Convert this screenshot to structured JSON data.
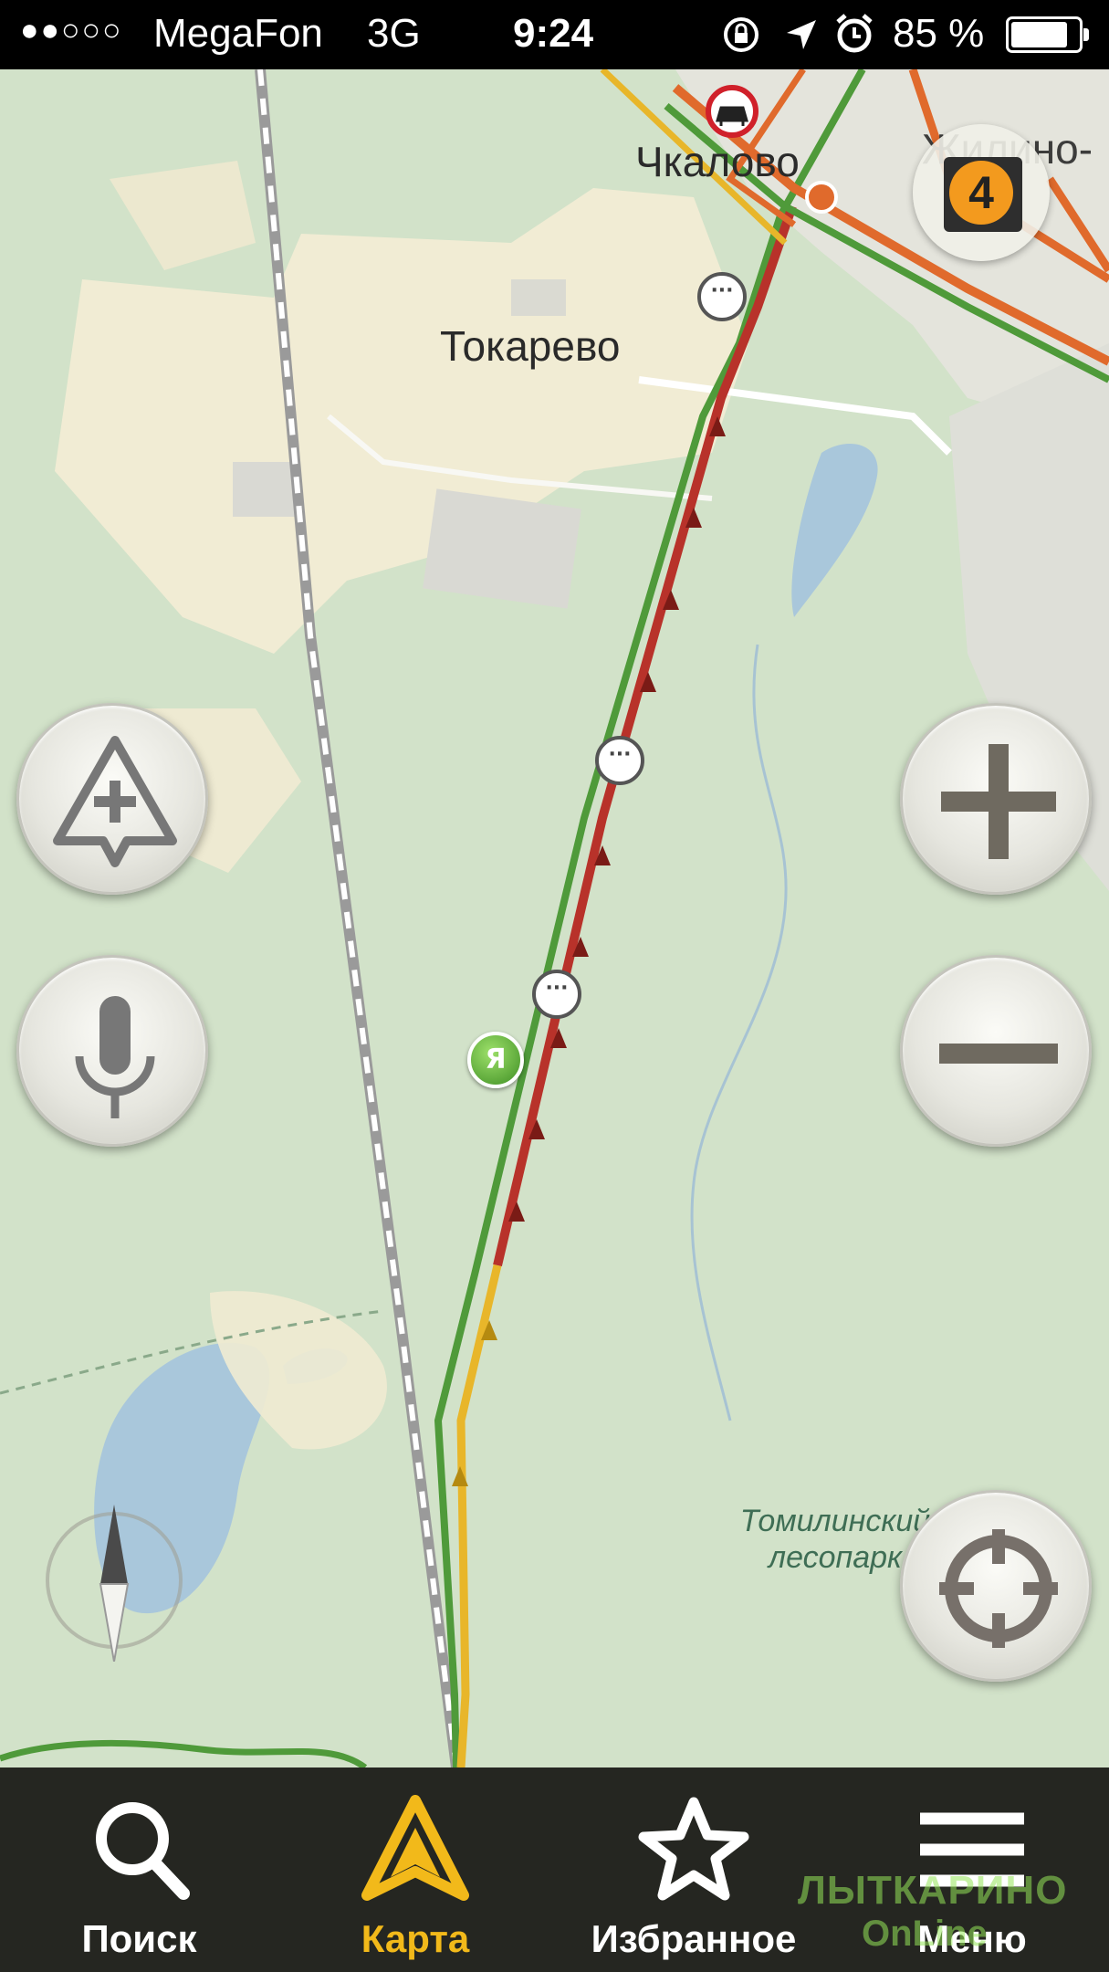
{
  "status_bar": {
    "signal_dots": "●●○○○",
    "carrier": "MegaFon",
    "network": "3G",
    "time": "9:24",
    "battery_percent": "85 %",
    "battery_level": 0.85
  },
  "map": {
    "places": {
      "tokarevo": "Токарево",
      "chkalovo": "Чкалово",
      "zhukovo_partial": "Жилино-"
    },
    "park_label": "Томилинский лесопарк",
    "road_event_count": "4",
    "user_marker_letter": "Я",
    "colors": {
      "jam": "#c0392b",
      "slow": "#e8b62a",
      "free": "#4f9a3a",
      "water": "#aac8dc",
      "forest": "#cfe1c6",
      "settlement": "#f3ecd3"
    }
  },
  "controls": {
    "add_event_icon": "warning-plus-icon",
    "voice_icon": "microphone-icon",
    "zoom_in_icon": "plus-icon",
    "zoom_out_icon": "minus-icon",
    "compass_icon": "compass-icon",
    "locate_icon": "crosshair-icon"
  },
  "tabs": [
    {
      "label": "Поиск",
      "icon": "search-icon",
      "active": false
    },
    {
      "label": "Карта",
      "icon": "navigation-arrow-icon",
      "active": true
    },
    {
      "label": "Избранное",
      "icon": "star-icon",
      "active": false
    },
    {
      "label": "Меню",
      "icon": "menu-icon",
      "active": false
    }
  ],
  "tab_active_color": "#f2b91a",
  "watermark": {
    "line1": "ЛЫТКАРИНО",
    "line2": "OnLine"
  }
}
